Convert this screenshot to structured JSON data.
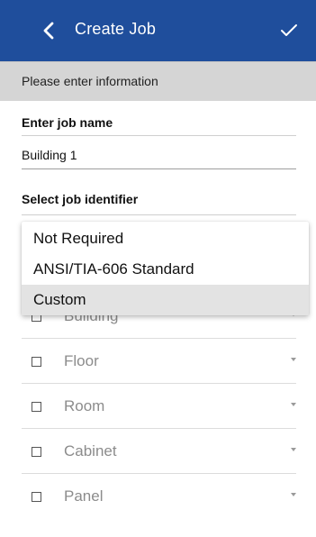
{
  "header": {
    "title": "Create Job",
    "back_icon": "chevron-left-icon",
    "confirm_icon": "checkmark-icon",
    "color": "#1f4e9c"
  },
  "subheader": {
    "text": "Please enter information"
  },
  "form": {
    "job_name_label": "Enter job name",
    "job_name_value": "Building 1",
    "identifier_label": "Select job identifier"
  },
  "dropdown": {
    "options": [
      "Not Required",
      "ANSI/TIA-606 Standard",
      "Custom"
    ],
    "highlighted": "Custom"
  },
  "identifier_fields": [
    {
      "label": "Building",
      "checked": false
    },
    {
      "label": "Floor",
      "checked": false
    },
    {
      "label": "Room",
      "checked": false
    },
    {
      "label": "Cabinet",
      "checked": false
    },
    {
      "label": "Panel",
      "checked": false
    }
  ]
}
